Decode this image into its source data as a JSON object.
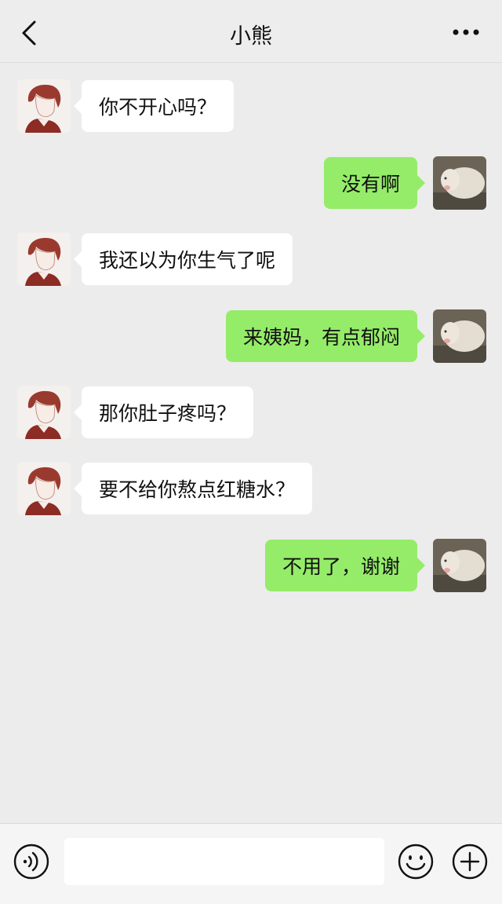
{
  "header": {
    "title": "小熊",
    "back_icon": "chevron-left-icon",
    "more_icon": "more-dots-icon"
  },
  "messages": [
    {
      "side": "left",
      "text": "你不开心吗？"
    },
    {
      "side": "right",
      "text": "没有啊"
    },
    {
      "side": "left",
      "text": "我还以为你生气了呢"
    },
    {
      "side": "right",
      "text": "来姨妈，有点郁闷"
    },
    {
      "side": "left",
      "text": "那你肚子疼吗？"
    },
    {
      "side": "left",
      "text": "要不给你熬点红糖水？"
    },
    {
      "side": "right",
      "text": "不用了，谢谢"
    }
  ],
  "input_bar": {
    "voice_icon": "voice-icon",
    "input_value": "",
    "emoji_icon": "emoji-icon",
    "plus_icon": "plus-icon"
  },
  "colors": {
    "background": "#ececec",
    "sent_bubble": "#95ec69",
    "received_bubble": "#ffffff",
    "text": "#111111"
  }
}
